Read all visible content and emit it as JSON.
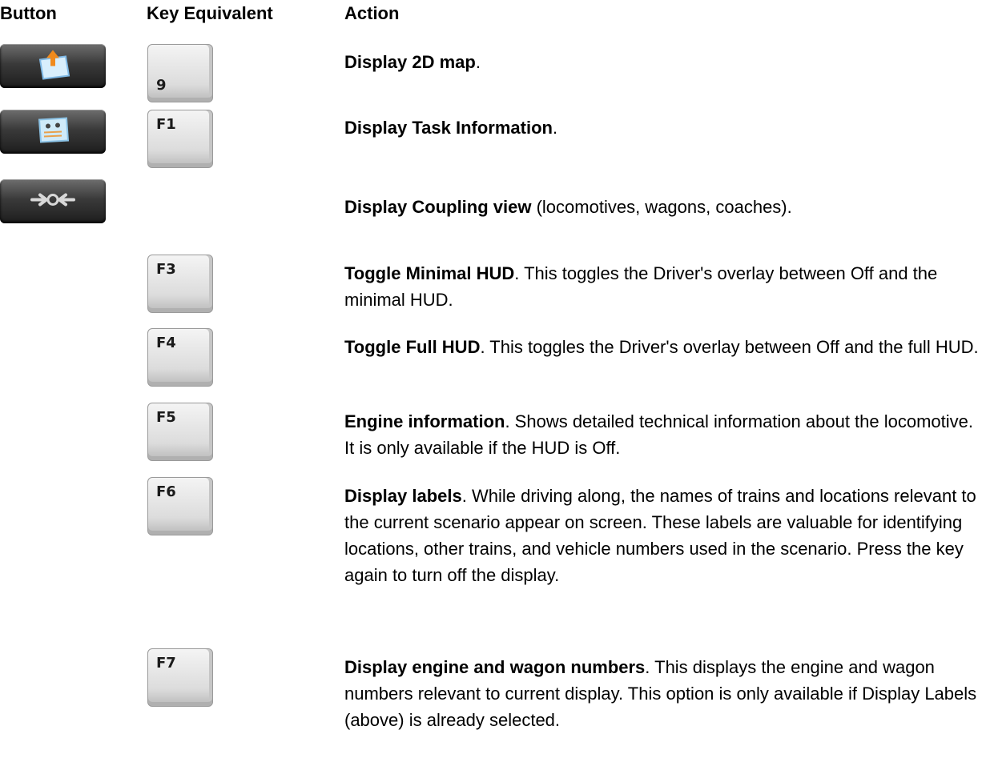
{
  "headers": {
    "button": "Button",
    "key": "Key Equivalent",
    "action": "Action"
  },
  "rows": [
    {
      "icon": "map-icon",
      "key": "9",
      "title": "Display 2D map",
      "desc": "."
    },
    {
      "icon": "task-info-icon",
      "key": "F1",
      "title": "Display Task Information",
      "desc": "."
    },
    {
      "icon": "coupling-icon",
      "key": "",
      "title": "Display Coupling view",
      "desc": " (locomotives, wagons, coaches)."
    },
    {
      "key": "F3",
      "title": "Toggle Minimal HUD",
      "desc": ". This toggles the Driver's overlay between Off and the minimal HUD."
    },
    {
      "key": "F4",
      "title": "Toggle Full HUD",
      "desc": ". This toggles the Driver's overlay between Off and the full HUD."
    },
    {
      "key": "F5",
      "title": "Engine information",
      "desc": ". Shows detailed technical information about the locomotive. It is only available if the HUD is Off."
    },
    {
      "key": "F6",
      "title": "Display labels",
      "desc": ". While driving along, the names of trains and locations relevant to the current scenario appear on screen. These labels are valuable for identifying locations, other trains, and vehicle numbers used in the scenario. Press the key again to turn off the display."
    },
    {
      "key": "F7",
      "title": "Display engine and wagon numbers",
      "desc": ". This displays the engine and wagon numbers relevant to current display. This option is only available if Display Labels (above) is already selected."
    }
  ]
}
